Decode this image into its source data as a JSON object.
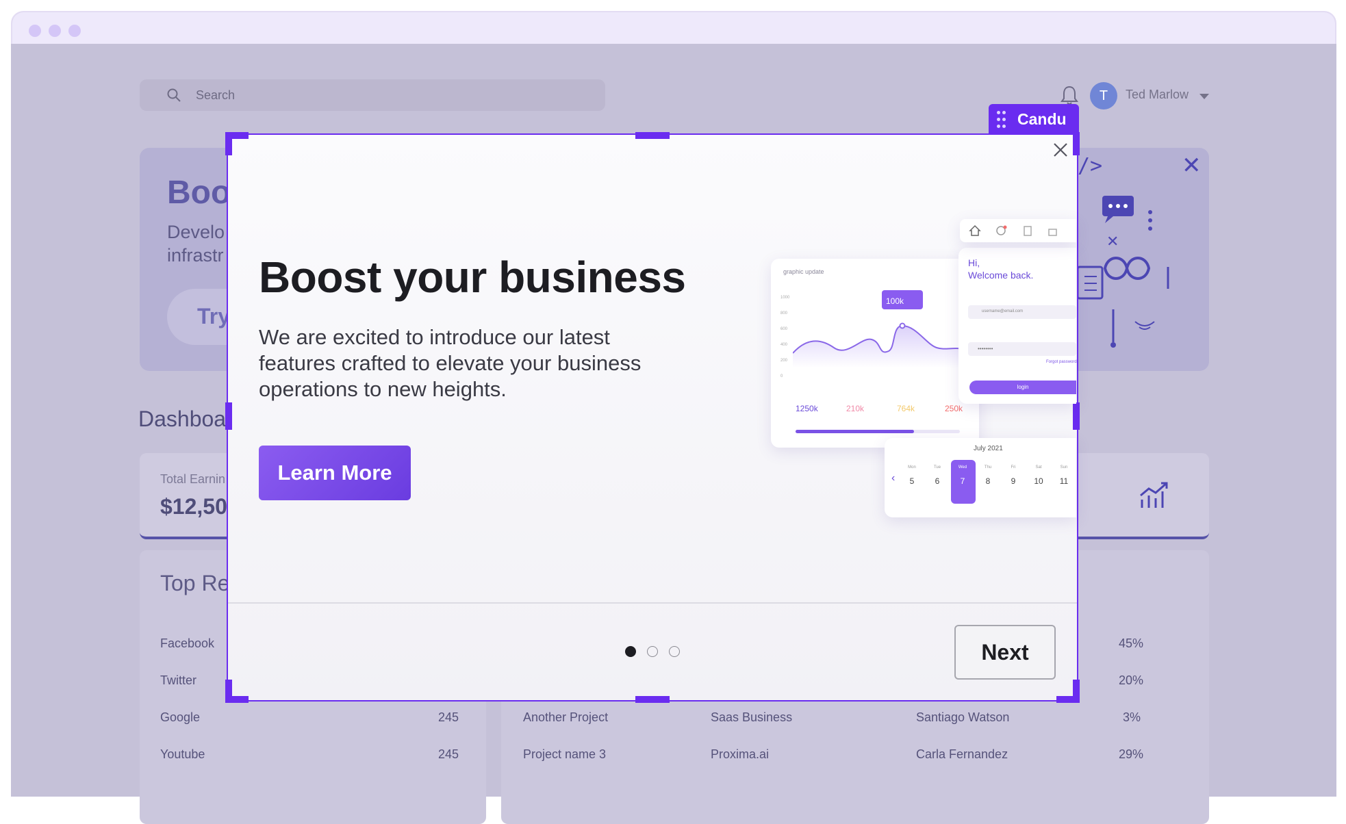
{
  "window": {
    "dot_colors": [
      "#d4c6f7",
      "#d4c6f7",
      "#d4c6f7"
    ]
  },
  "topbar": {
    "search_placeholder": "Search",
    "user_initial": "T",
    "user_name": "Ted Marlow"
  },
  "hero": {
    "title": "Boo",
    "subtitle_line1": "Develo",
    "subtitle_line2": "infrastr",
    "cta": "Try"
  },
  "dashboard": {
    "title": "Dashboar",
    "card_label": "Total Earnin",
    "card_value": "$12,50",
    "panel_title": "Top Re"
  },
  "left_table": [
    {
      "name": "Facebook",
      "value": ""
    },
    {
      "name": "Twitter",
      "value": ""
    },
    {
      "name": "Google",
      "value": "245"
    },
    {
      "name": "Youtube",
      "value": "245"
    }
  ],
  "right_table": [
    {
      "project": "",
      "company": "",
      "person": "",
      "pct": "45%"
    },
    {
      "project": "",
      "company": "",
      "person": "",
      "pct": "20%"
    },
    {
      "project": "Another Project",
      "company": "Saas Business",
      "person": "Santiago Watson",
      "pct": "3%"
    },
    {
      "project": "Project name 3",
      "company": "Proxima.ai",
      "person": "Carla Fernandez",
      "pct": "29%"
    }
  ],
  "candu": {
    "tag_label": "Candu",
    "accent": "#6a2cf0"
  },
  "modal": {
    "title": "Boost your business",
    "body": "We are excited to introduce our latest features crafted to elevate your business operations to new heights.",
    "learn_more": "Learn More",
    "next": "Next",
    "pager": {
      "count": 3,
      "active": 1
    }
  },
  "illustration": {
    "chart_card_title": "graphic update",
    "chart_tooltip": "100k",
    "y_ticks": [
      "1000",
      "800",
      "600",
      "400",
      "200",
      "0"
    ],
    "stats": [
      "1250k",
      "210k",
      "764k",
      "250k"
    ],
    "stat_colors": [
      "#6a4ad8",
      "#f08aa8",
      "#f3c96b",
      "#f26b6b"
    ],
    "login_greeting_1": "Hi,",
    "login_greeting_2": "Welcome back.",
    "login_user_value": "username@email.com",
    "login_password_value": "••••••••",
    "login_forgot": "Forgot password",
    "login_button": "login",
    "calendar_month": "July 2021",
    "calendar_days": [
      "Mon",
      "Tue",
      "Wed",
      "Thu",
      "Fri",
      "Sat",
      "Sun"
    ],
    "calendar_dates": [
      "5",
      "6",
      "7",
      "8",
      "9",
      "10",
      "11"
    ],
    "calendar_selected_index": 2
  }
}
